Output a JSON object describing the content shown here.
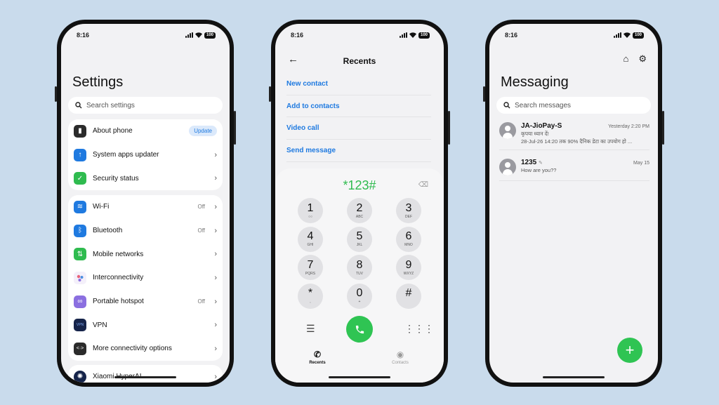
{
  "status": {
    "time": "8:16",
    "battery": "100"
  },
  "settings": {
    "title": "Settings",
    "search_placeholder": "Search settings",
    "group1": [
      {
        "label": "About phone",
        "badge": "Update",
        "icon": "phone-icon",
        "color": "#2b2b2b"
      },
      {
        "label": "System apps updater",
        "icon": "arrow-up-icon",
        "color": "#1f7ae0"
      },
      {
        "label": "Security status",
        "icon": "shield-icon",
        "color": "#2fbb4f"
      }
    ],
    "group2": [
      {
        "label": "Wi-Fi",
        "value": "Off",
        "icon": "wifi-icon",
        "color": "#1f7ae0"
      },
      {
        "label": "Bluetooth",
        "value": "Off",
        "icon": "bluetooth-icon",
        "color": "#1f7ae0"
      },
      {
        "label": "Mobile networks",
        "icon": "mobile-network-icon",
        "color": "#2fbb4f"
      },
      {
        "label": "Interconnectivity",
        "icon": "interconnectivity-icon",
        "color": "#f4f0fa"
      },
      {
        "label": "Portable hotspot",
        "value": "Off",
        "icon": "hotspot-icon",
        "color": "#8b6fe0"
      },
      {
        "label": "VPN",
        "icon": "vpn-icon",
        "color": "#16244a"
      },
      {
        "label": "More connectivity options",
        "icon": "more-connectivity-icon",
        "color": "#2b2b2b"
      }
    ],
    "group3": [
      {
        "label": "Xiaomi HyperAI",
        "icon": "hyperai-icon",
        "color": "#16244a"
      }
    ],
    "vpn_icon_text": "VPN"
  },
  "recents": {
    "title": "Recents",
    "actions": [
      "New contact",
      "Add to contacts",
      "Video call",
      "Send message"
    ],
    "dialed": "*123#",
    "keys": [
      {
        "digit": "1",
        "letters": ""
      },
      {
        "digit": "2",
        "letters": "ABC"
      },
      {
        "digit": "3",
        "letters": "DEF"
      },
      {
        "digit": "4",
        "letters": "GHI"
      },
      {
        "digit": "5",
        "letters": "JKL"
      },
      {
        "digit": "6",
        "letters": "MNO"
      },
      {
        "digit": "7",
        "letters": "PQRS"
      },
      {
        "digit": "8",
        "letters": "TUV"
      },
      {
        "digit": "9",
        "letters": "WXYZ"
      },
      {
        "digit": "*",
        "letters": ","
      },
      {
        "digit": "0",
        "letters": "+"
      },
      {
        "digit": "#",
        "letters": ""
      }
    ],
    "nav": [
      {
        "label": "Recents",
        "active": true
      },
      {
        "label": "Contacts",
        "active": false
      }
    ]
  },
  "messaging": {
    "title": "Messaging",
    "search_placeholder": "Search messages",
    "threads": [
      {
        "sender": "JA-JioPay-S",
        "time": "Yesterday 2:20 PM",
        "line1": "कृपया ध्यान दें!",
        "line2": "28-Jul-26 14:20 तक 90% दैनिक डेटा का उपयोग हो ..."
      },
      {
        "sender": "1235",
        "time": "May 15",
        "line1": "How are you??",
        "line2": ""
      }
    ]
  },
  "colors": {
    "accent": "#1f7ae0",
    "green": "#2fc453",
    "background": "#c9dbec"
  }
}
